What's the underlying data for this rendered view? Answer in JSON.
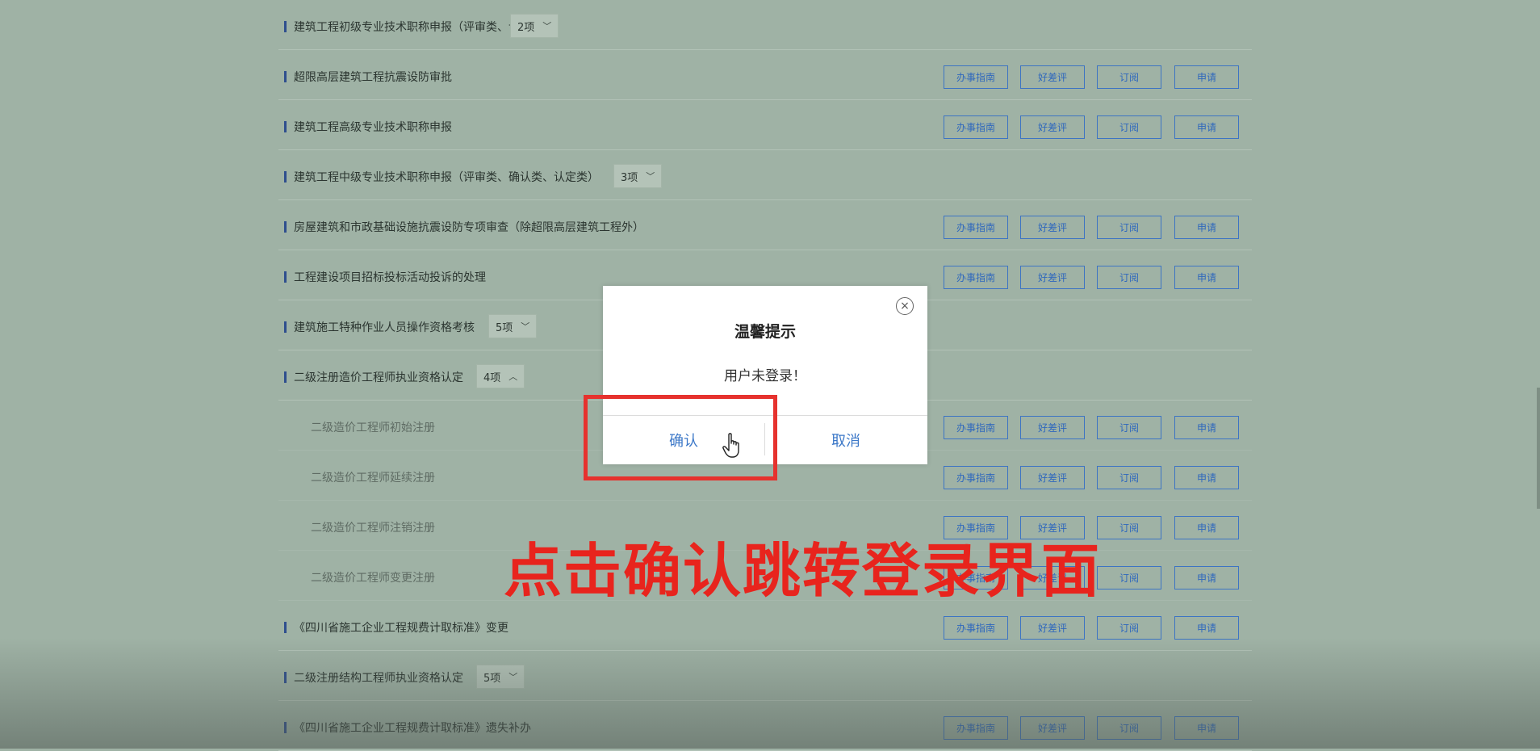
{
  "list": {
    "button_labels": [
      "办事指南",
      "好差评",
      "订阅",
      "申请"
    ],
    "rows": [
      {
        "label": "建筑工程初级专业技术职称申报（评审类、认定类）",
        "sub": false,
        "dropdown": "2项",
        "expanded": false,
        "buttons": false
      },
      {
        "label": "超限高层建筑工程抗震设防审批",
        "sub": false,
        "buttons": true
      },
      {
        "label": "建筑工程高级专业技术职称申报",
        "sub": false,
        "buttons": true
      },
      {
        "label": "建筑工程中级专业技术职称申报（评审类、确认类、认定类）",
        "sub": false,
        "dropdown": "3项",
        "expanded": false,
        "buttons": false
      },
      {
        "label": "房屋建筑和市政基础设施抗震设防专项审查（除超限高层建筑工程外）",
        "sub": false,
        "buttons": true
      },
      {
        "label": "工程建设项目招标投标活动投诉的处理",
        "sub": false,
        "buttons": true
      },
      {
        "label": "建筑施工特种作业人员操作资格考核",
        "sub": false,
        "dropdown": "5项",
        "expanded": false,
        "buttons": false
      },
      {
        "label": "二级注册造价工程师执业资格认定",
        "sub": false,
        "dropdown": "4项",
        "expanded": true,
        "buttons": false
      },
      {
        "label": "二级造价工程师初始注册",
        "sub": true,
        "buttons": true
      },
      {
        "label": "二级造价工程师延续注册",
        "sub": true,
        "buttons": true
      },
      {
        "label": "二级造价工程师注销注册",
        "sub": true,
        "buttons": true
      },
      {
        "label": "二级造价工程师变更注册",
        "sub": true,
        "buttons": true
      },
      {
        "label": "《四川省施工企业工程规费计取标准》变更",
        "sub": false,
        "buttons": true
      },
      {
        "label": "二级注册结构工程师执业资格认定",
        "sub": false,
        "dropdown": "5项",
        "expanded": false,
        "buttons": false
      },
      {
        "label": "《四川省施工企业工程规费计取标准》遗失补办",
        "sub": false,
        "buttons": true
      }
    ]
  },
  "modal": {
    "title": "温馨提示",
    "message": "用户未登录！",
    "confirm_label": "确认",
    "cancel_label": "取消",
    "close_symbol": "×"
  },
  "annotation": {
    "text": "点击确认跳转登录界面",
    "color": "#e8241d"
  },
  "colors": {
    "background": "#9fb2a5",
    "accent": "#2f68bd",
    "highlight": "#e6322e"
  },
  "icons": {
    "dropdown_collapsed": "chevron-down-icon",
    "dropdown_expanded": "chevron-up-icon",
    "close": "close-circle-icon",
    "cursor": "hand-pointer-icon"
  }
}
